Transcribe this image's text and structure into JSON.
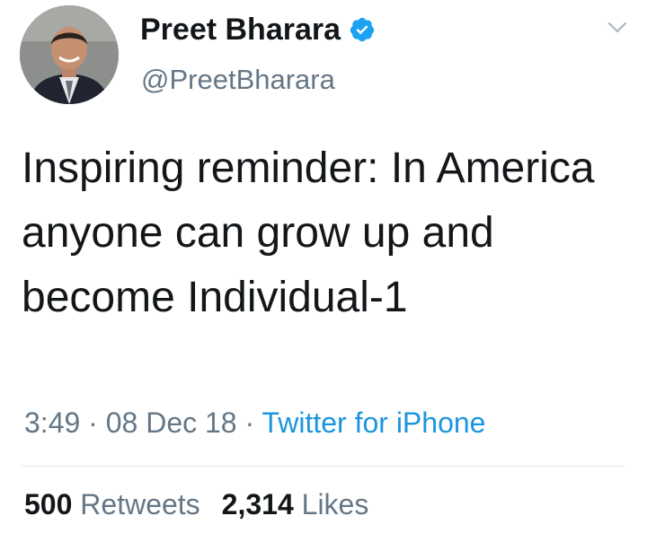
{
  "tweet": {
    "author": {
      "display_name": "Preet Bharara",
      "handle": "@PreetBharara",
      "verified": true,
      "verified_icon": "verified-badge-icon",
      "avatar": "avatar-photo"
    },
    "menu_icon": "chevron-down-icon",
    "text": "Inspiring reminder: In America anyone can grow up and become Individual-1",
    "meta": {
      "time": "3:49",
      "separator": "·",
      "date": "08 Dec 18",
      "source": "Twitter for iPhone"
    },
    "stats": {
      "retweets_count": "500",
      "retweets_label": "Retweets",
      "likes_count": "2,314",
      "likes_label": "Likes"
    }
  },
  "colors": {
    "text_primary": "#14171a",
    "text_secondary": "#657786",
    "link_blue": "#1b95e0",
    "verified_blue": "#1da1f2",
    "divider": "#e1e8ed"
  }
}
